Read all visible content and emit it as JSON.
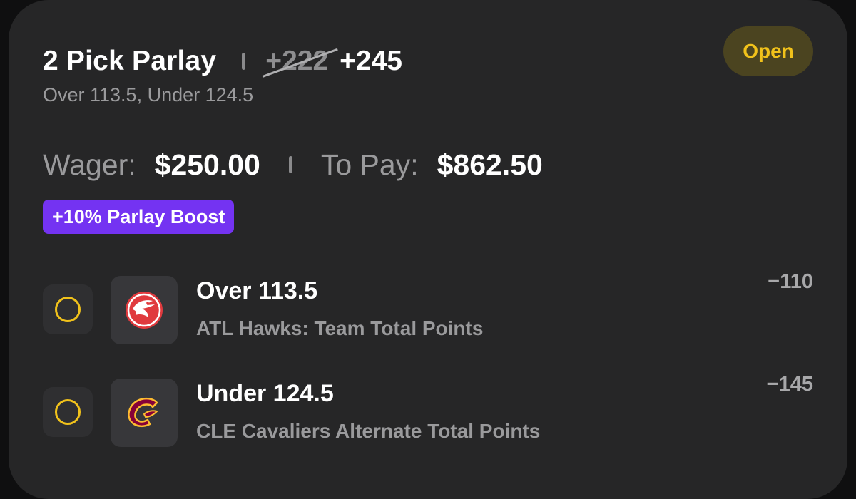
{
  "header": {
    "title": "2 Pick Parlay",
    "old_odds": "+222",
    "new_odds": "+245",
    "subtitle": "Over 113.5, Under 124.5",
    "status": "Open"
  },
  "wager": {
    "wager_label": "Wager:",
    "wager_amount": "$250.00",
    "pay_label": "To Pay:",
    "pay_amount": "$862.50"
  },
  "boost": {
    "label": "+10% Parlay Boost"
  },
  "picks": [
    {
      "title": "Over 113.5",
      "subtitle": "ATL Hawks: Team Total Points",
      "odds": "−110",
      "team_logo": "atl-hawks-logo"
    },
    {
      "title": "Under 124.5",
      "subtitle": "CLE Cavaliers Alternate Total Points",
      "odds": "−145",
      "team_logo": "cle-cavaliers-logo"
    }
  ],
  "colors": {
    "card_bg": "#262627",
    "accent_yellow": "#f1c21b",
    "boost_purple": "#7433f2",
    "hawks_red": "#e03a3e",
    "cavs_wine": "#860038",
    "cavs_gold": "#fdbb30"
  }
}
